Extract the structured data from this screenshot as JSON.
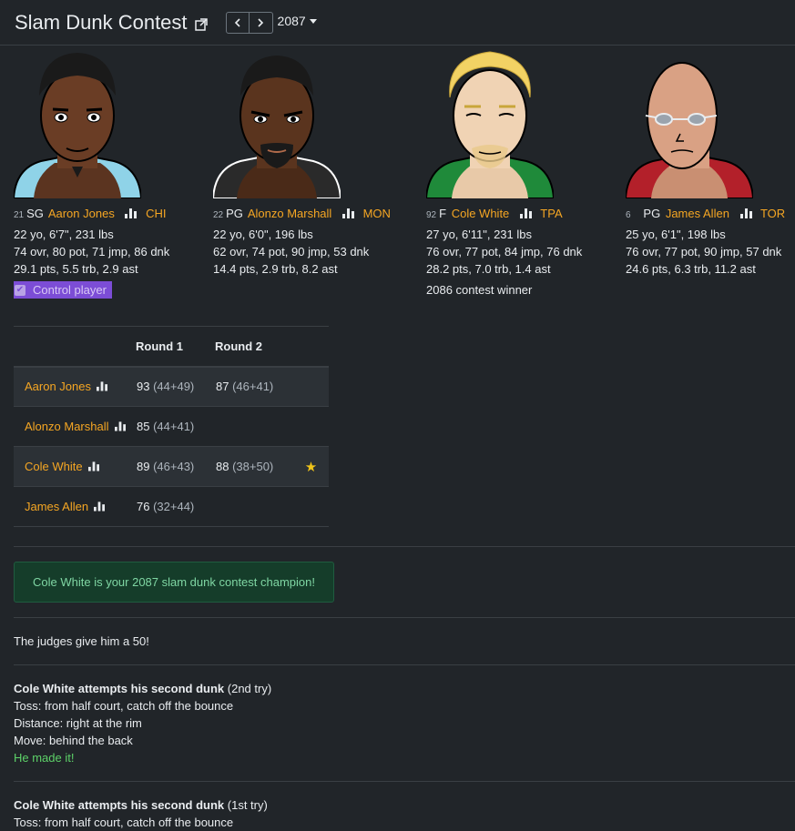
{
  "header": {
    "title": "Slam Dunk Contest",
    "season": "2087"
  },
  "players": [
    {
      "jersey": "21",
      "pos": "SG",
      "name": "Aaron Jones",
      "team": "CHI",
      "bio": "22 yo, 6'7\", 231 lbs",
      "ratings": "74 ovr, 80 pot, 71 jmp, 86 dnk",
      "stats": "29.1 pts, 5.5 trb, 2.9 ast",
      "control_label": "Control player",
      "jersey_color": "#8fd3e8"
    },
    {
      "jersey": "22",
      "pos": "PG",
      "name": "Alonzo Marshall",
      "team": "MON",
      "bio": "22 yo, 6'0\", 196 lbs",
      "ratings": "62 ovr, 74 pot, 90 jmp, 53 dnk",
      "stats": "14.4 pts, 2.9 trb, 8.2 ast",
      "jersey_color": "#2a2a2a"
    },
    {
      "jersey": "92",
      "pos": "F",
      "name": "Cole White",
      "team": "TPA",
      "bio": "27 yo, 6'11\", 231 lbs",
      "ratings": "76 ovr, 77 pot, 84 jmp, 76 dnk",
      "stats": "28.2 pts, 7.0 trb, 1.4 ast",
      "note": "2086 contest winner",
      "jersey_color": "#1f8a3a"
    },
    {
      "jersey": "6",
      "pos": "PG",
      "name": "James Allen",
      "team": "TOR",
      "bio": "25 yo, 6'1\", 198 lbs",
      "ratings": "76 ovr, 77 pot, 90 jmp, 57 dnk",
      "stats": "24.6 pts, 6.3 trb, 11.2 ast",
      "jersey_color": "#b3202a"
    }
  ],
  "results": {
    "headers": [
      "Round 1",
      "Round 2"
    ],
    "rows": [
      {
        "name": "Aaron Jones",
        "r1": "93",
        "r1_detail": "(44+49)",
        "r2": "87",
        "r2_detail": "(46+41)",
        "winner": false
      },
      {
        "name": "Alonzo Marshall",
        "r1": "85",
        "r1_detail": "(44+41)",
        "r2": "",
        "r2_detail": "",
        "winner": false
      },
      {
        "name": "Cole White",
        "r1": "89",
        "r1_detail": "(46+43)",
        "r2": "88",
        "r2_detail": "(38+50)",
        "winner": true
      },
      {
        "name": "James Allen",
        "r1": "76",
        "r1_detail": "(32+44)",
        "r2": "",
        "r2_detail": "",
        "winner": false
      }
    ],
    "star": "★"
  },
  "champion_alert": "Cole White is your 2087 slam dunk contest champion!",
  "log": {
    "judges": "The judges give him a 50!",
    "entry1": {
      "title": "Cole White attempts his second dunk",
      "try": "(2nd try)",
      "toss": "Toss: from half court, catch off the bounce",
      "distance": "Distance: right at the rim",
      "move": "Move: behind the back",
      "result": "He made it!"
    },
    "entry2": {
      "title": "Cole White attempts his second dunk",
      "try": "(1st try)",
      "toss": "Toss: from half court, catch off the bounce"
    }
  },
  "colors": {
    "background": "#212529",
    "link": "#f5a623",
    "success": "#5dd168",
    "control_bg": "#7c4dd6"
  }
}
